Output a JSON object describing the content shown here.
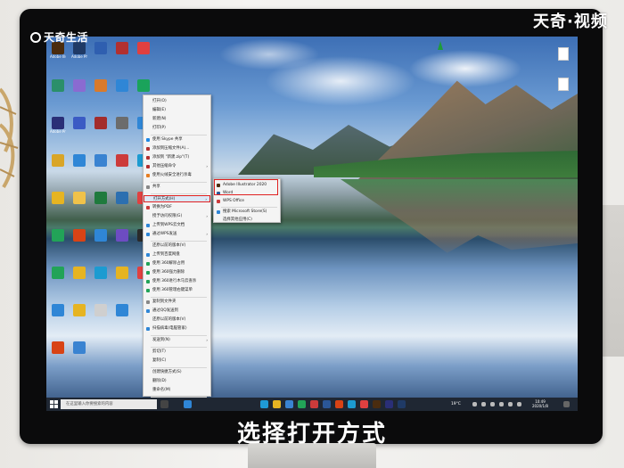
{
  "watermark": {
    "left": "天奇生活",
    "right": "天奇·视频"
  },
  "caption": "选择打开方式",
  "desktop_icons": [
    {
      "label": "Adobe\nIllustrat...",
      "color": "#4a2c0f"
    },
    {
      "label": "Adobe\nPhotosh...",
      "color": "#1f3a66"
    },
    {
      "label": "",
      "color": "#2f5fb0"
    },
    {
      "label": "",
      "color": "#b23030"
    },
    {
      "label": "",
      "color": "#e04040"
    },
    {
      "label": "",
      "color": "#2b8f6a"
    },
    {
      "label": "",
      "color": "#8a6bd1"
    },
    {
      "label": "",
      "color": "#d97a2b"
    },
    {
      "label": "",
      "color": "#2f86d6"
    },
    {
      "label": "",
      "color": "#1aa35b"
    },
    {
      "label": "Adobe\nPremie...",
      "color": "#2a2f77"
    },
    {
      "label": "",
      "color": "#3b5bc4"
    },
    {
      "label": "",
      "color": "#a32c2c"
    },
    {
      "label": "",
      "color": "#6c6c6c"
    },
    {
      "label": "",
      "color": "#2f86d6"
    },
    {
      "label": "",
      "color": "#d9a527"
    },
    {
      "label": "",
      "color": "#2f86d6"
    },
    {
      "label": "",
      "color": "#3a83d1"
    },
    {
      "label": "",
      "color": "#cc3b3b"
    },
    {
      "label": "",
      "color": "#1c9bd1"
    },
    {
      "label": "",
      "color": "#e6b422"
    },
    {
      "label": "",
      "color": "#f0c24a"
    },
    {
      "label": "",
      "color": "#1f7a3d"
    },
    {
      "label": "",
      "color": "#2c6fb0"
    },
    {
      "label": "",
      "color": "#e04040"
    },
    {
      "label": "",
      "color": "#22a358"
    },
    {
      "label": "",
      "color": "#d84315"
    },
    {
      "label": "",
      "color": "#2f86d6"
    },
    {
      "label": "",
      "color": "#6d4cc2"
    },
    {
      "label": "",
      "color": "#2a2a2a"
    },
    {
      "label": "",
      "color": "#22a358"
    },
    {
      "label": "",
      "color": "#e6b422"
    },
    {
      "label": "",
      "color": "#1c9bd1"
    },
    {
      "label": "",
      "color": "#e6b422"
    },
    {
      "label": "",
      "color": "#e04040"
    },
    {
      "label": "",
      "color": "#2f86d6"
    },
    {
      "label": "",
      "color": "#e6b422"
    },
    {
      "label": "",
      "color": "#cfcfcf"
    },
    {
      "label": "",
      "color": "#2f86d6"
    },
    {
      "label": "",
      "color": "#f0c24a"
    },
    {
      "label": "",
      "color": "#d84315"
    },
    {
      "label": "",
      "color": "#3a83d1"
    }
  ],
  "context_menu": {
    "items": [
      {
        "label": "打开(O)",
        "icon": "",
        "arrow": false
      },
      {
        "label": "编辑(E)",
        "icon": "",
        "arrow": false
      },
      {
        "label": "新建(N)",
        "icon": "",
        "arrow": false
      },
      {
        "label": "打印(P)",
        "icon": "",
        "arrow": false
      },
      {
        "label": "使用 Skype 共享",
        "icon": "#1e88e5",
        "arrow": false
      },
      {
        "label": "添加到压缩文件(A)...",
        "icon": "#b23030",
        "arrow": false
      },
      {
        "label": "添加到 \"新建.zip\"(T)",
        "icon": "#b23030",
        "arrow": false
      },
      {
        "label": "其他压缩命令",
        "icon": "#b23030",
        "arrow": true
      },
      {
        "label": "使用火绒安全进行杀毒",
        "icon": "#e67e22",
        "arrow": false
      },
      {
        "label": "共享",
        "icon": "#888",
        "arrow": false
      },
      {
        "label": "打开方式(H)",
        "icon": "",
        "arrow": true,
        "highlight": true
      },
      {
        "label": "转换为PDF",
        "icon": "#cc3b3b",
        "arrow": false
      },
      {
        "label": "授予访问权限(G)",
        "icon": "",
        "arrow": true
      },
      {
        "label": "上传到WPS云文档",
        "icon": "#2f86d6",
        "arrow": false
      },
      {
        "label": "通过WPS发送",
        "icon": "#2f86d6",
        "arrow": true
      },
      {
        "label": "还原以前的版本(V)",
        "icon": "",
        "arrow": false
      },
      {
        "label": "上传到百度网盘",
        "icon": "#2f86d6",
        "arrow": false
      },
      {
        "label": "使用 360解除占用",
        "icon": "#22a358",
        "arrow": false
      },
      {
        "label": "使用 360强力删除",
        "icon": "#22a358",
        "arrow": false
      },
      {
        "label": "使用 360进行木马云查杀",
        "icon": "#22a358",
        "arrow": false
      },
      {
        "label": "使用 360管理右键菜单",
        "icon": "#22a358",
        "arrow": false
      },
      {
        "label": "复制到文件夹",
        "icon": "#888",
        "arrow": false
      },
      {
        "label": "通过QQ发送到",
        "icon": "#2f86d6",
        "arrow": false
      },
      {
        "label": "还原以前的版本(V)",
        "icon": "",
        "arrow": false
      },
      {
        "label": "扫描病毒(电脑管家)",
        "icon": "#2f86d6",
        "arrow": false
      },
      {
        "label": "发送到(N)",
        "icon": "",
        "arrow": true
      },
      {
        "label": "剪切(T)",
        "icon": "",
        "arrow": false
      },
      {
        "label": "复制(C)",
        "icon": "",
        "arrow": false
      },
      {
        "label": "创建快捷方式(S)",
        "icon": "",
        "arrow": false
      },
      {
        "label": "删除(D)",
        "icon": "",
        "arrow": false
      },
      {
        "label": "重命名(M)",
        "icon": "",
        "arrow": false
      },
      {
        "label": "属性(R)",
        "icon": "",
        "arrow": false
      }
    ]
  },
  "submenu": {
    "items": [
      {
        "label": "Adobe Illustrator 2020",
        "icon": "#4a2c0f"
      },
      {
        "label": "Word",
        "icon": "#2b5797"
      },
      {
        "label": "WPS Office",
        "icon": "#cc3b3b"
      },
      {
        "label": "搜索 Microsoft Store(S)",
        "icon": "#2f86d6"
      },
      {
        "label": "选择其他应用(C)",
        "icon": ""
      }
    ]
  },
  "taskbar": {
    "search_placeholder": "在这里输入你要搜索的内容",
    "weather": "19°C",
    "time": "10:49",
    "date": "2020/1/8"
  }
}
